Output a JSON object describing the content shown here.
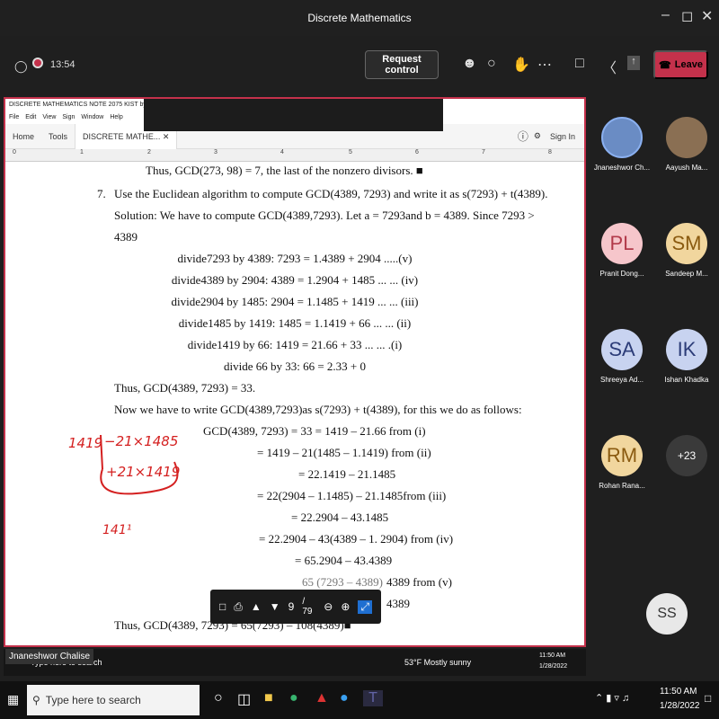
{
  "window": {
    "title": "Discrete Mathematics"
  },
  "call": {
    "timer": "13:54",
    "request_control": "Request control",
    "leave": "Leave"
  },
  "acrobat": {
    "title": "DISCRETE MATHEMATICS NOTE 2075 KIST by JN.pdf - Adobe",
    "menu": [
      "File",
      "Edit",
      "View",
      "Sign",
      "Window",
      "Help"
    ],
    "tabs": [
      "Home",
      "Tools",
      "DISCRETE MATHE..."
    ],
    "sign_in": "Sign In",
    "ruler": [
      "0",
      "1",
      "2",
      "3",
      "4",
      "5",
      "6",
      "7",
      "8"
    ],
    "page_current": "9",
    "page_total": "/ 79"
  },
  "doc": {
    "l0": "Thus,  GCD(273, 98) = 7, the last of the nonzero divisors.  ■",
    "num7": "7.",
    "l1": "Use the Euclidean algorithm to compute GCD(4389, 7293) and write it as s(7293) + t(4389).",
    "l2": "Solution: We have to compute GCD(4389,7293). Let a = 7293and b = 4389. Since 7293  >",
    "l3": "4389",
    "d1": "divide7293 by 4389: 7293  =  1.4389 + 2904  .....(v)",
    "d2": "divide4389 by 2904: 4389  =  1.2904 + 1485  ... ... (iv)",
    "d3": "divide2904 by 1485: 2904  =  1.1485 + 1419  ... ... (iii)",
    "d4": "divide1485 by 1419: 1485  =  1.1419 + 66  ... ... (ii)",
    "d5": "divide1419 by  66: 1419  =  21.66 + 33  ... ... .(i)",
    "d6": "divide 66 by 33: 66  =  2.33 + 0",
    "l4": "Thus,  GCD(4389, 7293) = 33.",
    "l5": "Now we have to write GCD(4389,7293)as s(7293) + t(4389), for this we do as follows:",
    "e1": "GCD(4389, 7293)  =  33  =  1419 – 21.66  from (i)",
    "e2": "= 1419 – 21(1485 – 1.1419)  from (ii)",
    "e3": "= 22.1419 – 21.1485",
    "e4": "= 22(2904  –  1.1485) –  21.1485from (iii)",
    "e5": "= 22.2904 – 43.1485",
    "e6": "= 22.2904 – 43(4389 – 1. 2904) from (iv)",
    "e7": "= 65.2904 – 43.4389",
    "e8": "4389 from (v)",
    "e9": "4389",
    "e8_partial": "65 (7293 – 4389)",
    "last": "Thus, GCD(4389, 7293)  =  65(7293) – 108(4389)■"
  },
  "ink": {
    "a": "1419",
    "b": "−21×1485",
    "c": "+21×1419",
    "d": "141¹"
  },
  "presenter_tag": "Jnaneshwor Chalise",
  "inner_taskbar": {
    "search": "Type here to search",
    "weather": "53°F  Mostly sunny",
    "time": "11:50 AM",
    "date": "1/28/2022"
  },
  "participants": [
    {
      "initials": "",
      "name": "Jnaneshwor Ch...",
      "color": "#6a8cc4",
      "text": "#fff"
    },
    {
      "initials": "",
      "name": "Aayush Ma...",
      "color": "#8a6f53",
      "text": "#fff"
    },
    {
      "initials": "PL",
      "name": "Pranit Dong...",
      "color": "#f6c6cb",
      "text": "#b23a4a"
    },
    {
      "initials": "SM",
      "name": "Sandeep M...",
      "color": "#f1d69e",
      "text": "#8a5a10"
    },
    {
      "initials": "SA",
      "name": "Shreeya Ad...",
      "color": "#c8d3f0",
      "text": "#2c3c78"
    },
    {
      "initials": "IK",
      "name": "Ishan Khadka",
      "color": "#c8d3f0",
      "text": "#2c3c78"
    },
    {
      "initials": "RM",
      "name": "Rohan Rana...",
      "color": "#f1d69e",
      "text": "#8a5a10"
    },
    {
      "initials": "+23",
      "name": "",
      "color": "#3a3a3a",
      "text": "#fff"
    }
  ],
  "self_view": {
    "initials": "SS"
  },
  "taskbar": {
    "search": "Type here to search",
    "time": "11:50 AM",
    "date": "1/28/2022"
  }
}
